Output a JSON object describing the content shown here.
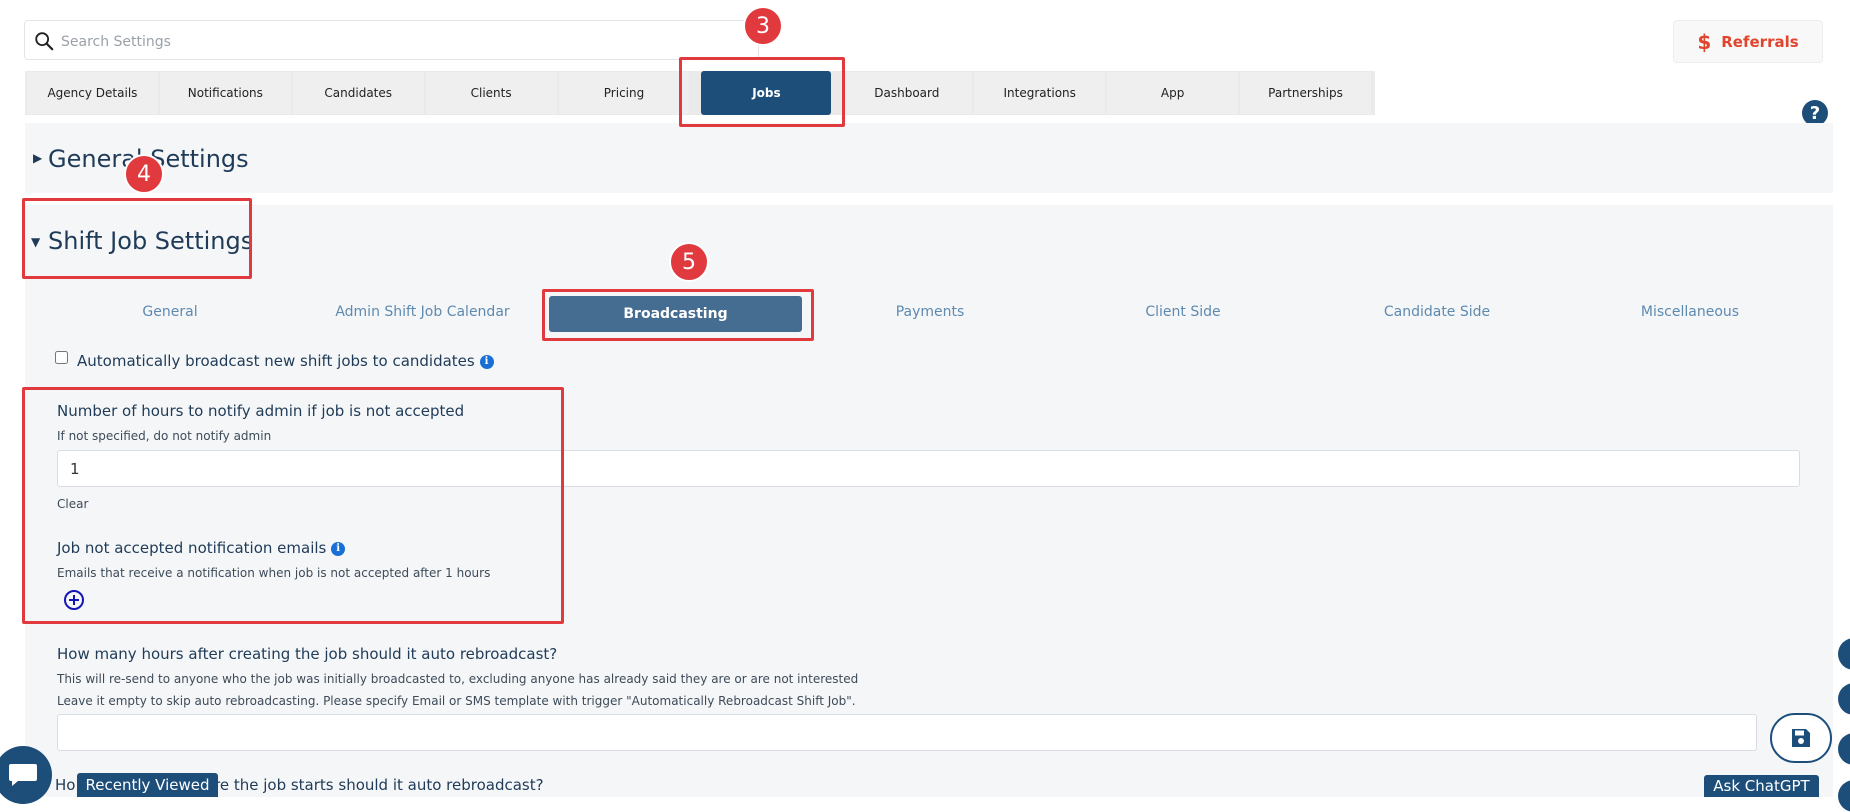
{
  "search": {
    "placeholder": "Search Settings"
  },
  "referrals": {
    "icon": "dollar-icon",
    "label": "Referrals"
  },
  "top_tabs": [
    "Agency Details",
    "Notifications",
    "Candidates",
    "Clients",
    "Pricing",
    "Jobs",
    "Dashboard",
    "Integrations",
    "App",
    "Partnerships"
  ],
  "active_top_tab": "Jobs",
  "help": {
    "label": "?"
  },
  "sections": {
    "general": {
      "title": "General Settings"
    },
    "shift": {
      "title": "Shift Job Settings"
    }
  },
  "sub_tabs": [
    "General",
    "Admin Shift Job Calendar",
    "Broadcasting",
    "Payments",
    "Client Side",
    "Candidate Side",
    "Miscellaneous"
  ],
  "active_sub_tab": "Broadcasting",
  "auto_broadcast": {
    "label": "Automatically broadcast new shift jobs to candidates",
    "checked": false
  },
  "notify_hours": {
    "label": "Number of hours to notify admin if job is not accepted",
    "hint": "If not specified, do not notify admin",
    "value": "1",
    "clear_label": "Clear"
  },
  "notify_emails": {
    "label": "Job not accepted notification emails",
    "hint": "Emails that receive a notification when job is not accepted after 1 hours"
  },
  "rebroadcast_after": {
    "label": "How many hours after creating the job should it auto rebroadcast?",
    "hint1": "This will re-send to anyone who the job was initially broadcasted to, excluding anyone has already said they are or are not interested",
    "hint2": "Leave it empty to skip auto rebroadcasting. Please specify Email or SMS template with trigger \"Automatically Rebroadcast Shift Job\".",
    "value": ""
  },
  "rebroadcast_before": {
    "label_prefix": "Ho",
    "label_suffix": "re the job starts should it auto rebroadcast?"
  },
  "recently_viewed": "Recently Viewed",
  "ask_chatgpt": "Ask ChatGPT",
  "annotations": {
    "step3": "3",
    "step4": "4",
    "step5": "5"
  },
  "colors": {
    "primary": "#1d4e7a",
    "accent": "#e0452e",
    "annotation": "#e03a3e",
    "subtab_active": "#456d92"
  }
}
